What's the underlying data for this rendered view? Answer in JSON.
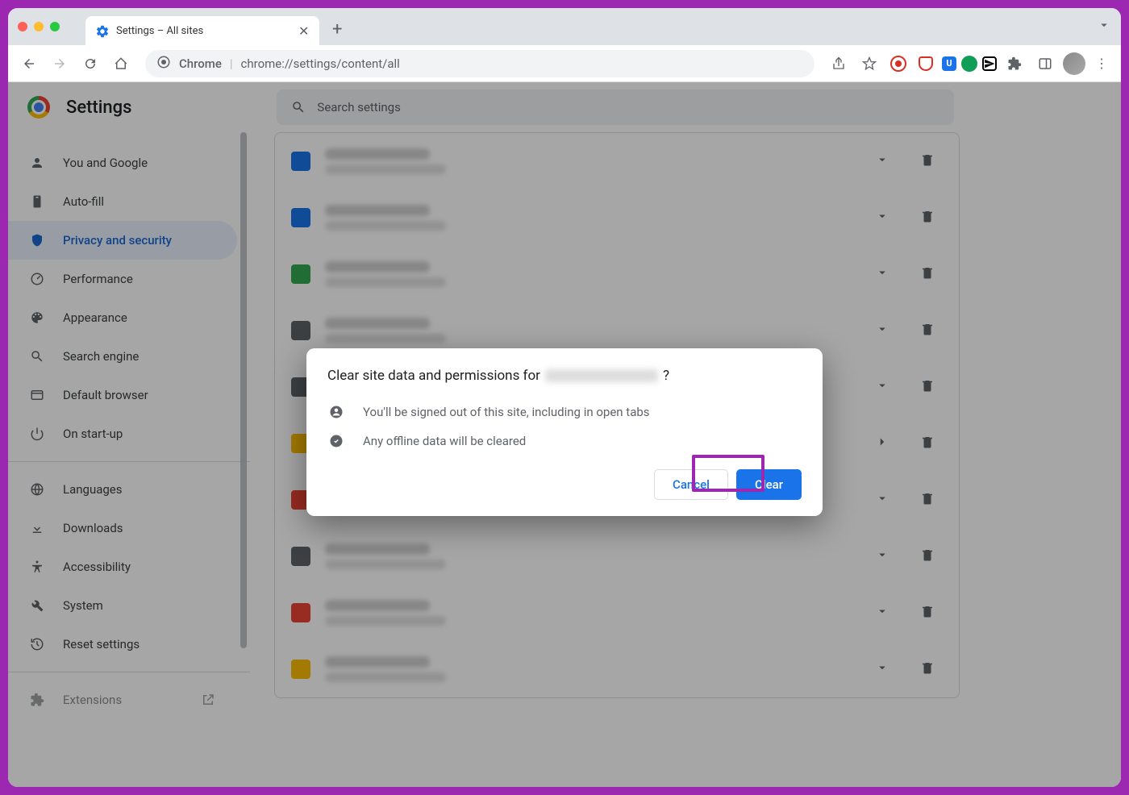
{
  "tab": {
    "title": "Settings – All sites"
  },
  "omnibox": {
    "prefix": "Chrome",
    "url": "chrome://settings/content/all"
  },
  "header": {
    "title": "Settings"
  },
  "search": {
    "placeholder": "Search settings"
  },
  "sidebar": {
    "items": [
      {
        "label": "You and Google",
        "icon": "person-icon"
      },
      {
        "label": "Auto-fill",
        "icon": "clipboard-icon"
      },
      {
        "label": "Privacy and security",
        "icon": "shield-icon",
        "active": true
      },
      {
        "label": "Performance",
        "icon": "speedometer-icon"
      },
      {
        "label": "Appearance",
        "icon": "palette-icon"
      },
      {
        "label": "Search engine",
        "icon": "search-icon"
      },
      {
        "label": "Default browser",
        "icon": "browser-icon"
      },
      {
        "label": "On start-up",
        "icon": "power-icon"
      }
    ],
    "items2": [
      {
        "label": "Languages",
        "icon": "globe-icon"
      },
      {
        "label": "Downloads",
        "icon": "download-icon"
      },
      {
        "label": "Accessibility",
        "icon": "accessibility-icon"
      },
      {
        "label": "System",
        "icon": "wrench-icon"
      },
      {
        "label": "Reset settings",
        "icon": "history-icon"
      }
    ],
    "extensions_label": "Extensions"
  },
  "site_colors": [
    "#1a73e8",
    "#1a73e8",
    "#34a853",
    "#5f6368",
    "#5f6368",
    "#fbbc05",
    "#ea4335",
    "#5f6368",
    "#ea4335",
    "#fbbc05"
  ],
  "dialog": {
    "title_prefix": "Clear site data and permissions for ",
    "title_suffix": "?",
    "line1": "You'll be signed out of this site, including in open tabs",
    "line2": "Any offline data will be cleared",
    "cancel": "Cancel",
    "clear": "Clear"
  }
}
